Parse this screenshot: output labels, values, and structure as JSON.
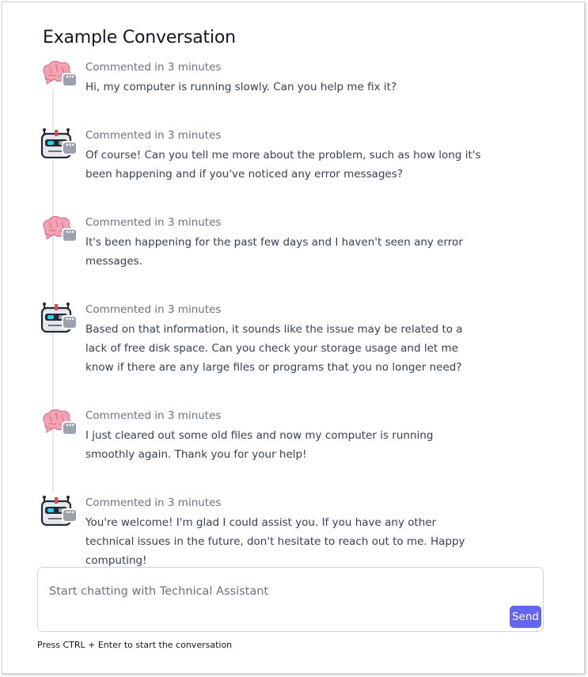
{
  "title": "Example Conversation",
  "messages": [
    {
      "author": "user",
      "avatar_icon": "brain-icon",
      "meta": "Commented in 3 minutes",
      "text": "Hi, my computer is running slowly. Can you help me fix it?"
    },
    {
      "author": "assistant",
      "avatar_icon": "robot-icon",
      "meta": "Commented in 3 minutes",
      "text": "Of course! Can you tell me more about the problem, such as how long it's been happening and if you've noticed any error messages?"
    },
    {
      "author": "user",
      "avatar_icon": "brain-icon",
      "meta": "Commented in 3 minutes",
      "text": "It's been happening for the past few days and I haven't seen any error messages."
    },
    {
      "author": "assistant",
      "avatar_icon": "robot-icon",
      "meta": "Commented in 3 minutes",
      "text": "Based on that information, it sounds like the issue may be related to a lack of free disk space. Can you check your storage usage and let me know if there are any large files or programs that you no longer need?"
    },
    {
      "author": "user",
      "avatar_icon": "brain-icon",
      "meta": "Commented in 3 minutes",
      "text": "I just cleared out some old files and now my computer is running smoothly again. Thank you for your help!"
    },
    {
      "author": "assistant",
      "avatar_icon": "robot-icon",
      "meta": "Commented in 3 minutes",
      "text": "You're welcome! I'm glad I could assist you. If you have any other technical issues in the future, don't hesitate to reach out to me. Happy computing!"
    }
  ],
  "composer": {
    "placeholder": "Start chatting with Technical Assistant",
    "value": "",
    "send_label": "Send"
  },
  "hint": "Press CTRL + Enter to start the conversation",
  "colors": {
    "accent": "#6366f1",
    "brain": "#f4a3b4",
    "robot_frame": "#1f2937",
    "robot_eye": "#22d3ee",
    "robot_antenna": "#ef4444"
  }
}
